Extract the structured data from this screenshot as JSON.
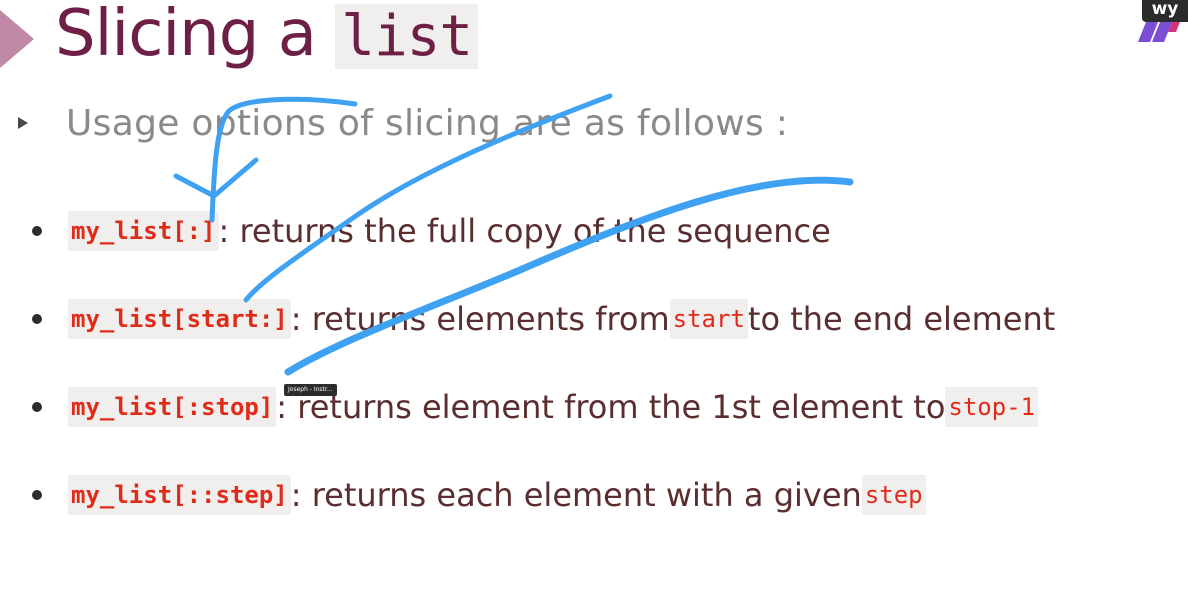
{
  "title": {
    "text": "Slicing a ",
    "code": "list"
  },
  "brand": {
    "text": "wy"
  },
  "subtitle": "Usage options of slicing are as follows :",
  "items": [
    {
      "code": "my_list[:]",
      "text": ": returns the full copy of the sequence"
    },
    {
      "code": "my_list[start:]",
      "text": " : returns elements from ",
      "code2": "start",
      "text2": " to the end element"
    },
    {
      "code": "my_list[:stop]",
      "text": " : returns element from the 1st element to ",
      "code2": "stop-1"
    },
    {
      "code": "my_list[::step]",
      "text": " : returns each element with a given ",
      "code2": "step"
    }
  ],
  "tooltip": "Joseph - Instr...",
  "colors": {
    "title": "#6d1f45",
    "code": "#e02b18",
    "annotation": "#3fa1f2",
    "arrow": "#c08aa6"
  }
}
